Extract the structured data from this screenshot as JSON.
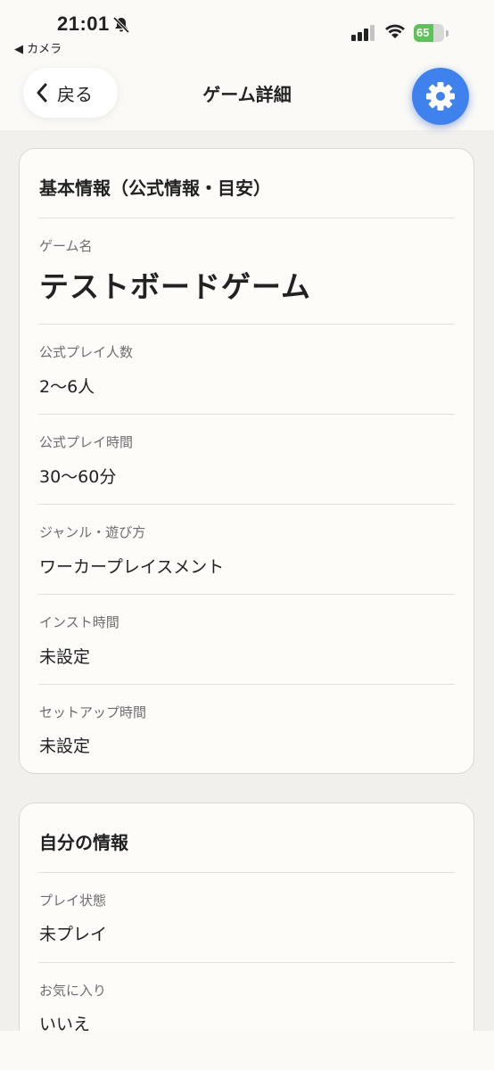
{
  "status_bar": {
    "time": "21:01",
    "back_app": "◀ カメラ",
    "battery": "65",
    "battery_level": 0.65,
    "battery_color": "#5fc15a"
  },
  "nav": {
    "back_label": "戻る",
    "title": "ゲーム詳細",
    "settings_icon": "gear-icon",
    "accent": "#3f82ee"
  },
  "basic_info": {
    "title": "基本情報（公式情報・目安）",
    "game_name_label": "ゲーム名",
    "game_name": "テストボードゲーム",
    "players_label": "公式プレイ人数",
    "players": "2〜6人",
    "play_time_label": "公式プレイ時間",
    "play_time": "30〜60分",
    "genre_label": "ジャンル・遊び方",
    "genre": "ワーカープレイスメント",
    "instruction_time_label": "インスト時間",
    "instruction_time": "未設定",
    "setup_time_label": "セットアップ時間",
    "setup_time": "未設定"
  },
  "my_info": {
    "title": "自分の情報",
    "play_status_label": "プレイ状態",
    "play_status": "未プレイ",
    "favorite_label": "お気に入り",
    "favorite": "いいえ"
  }
}
